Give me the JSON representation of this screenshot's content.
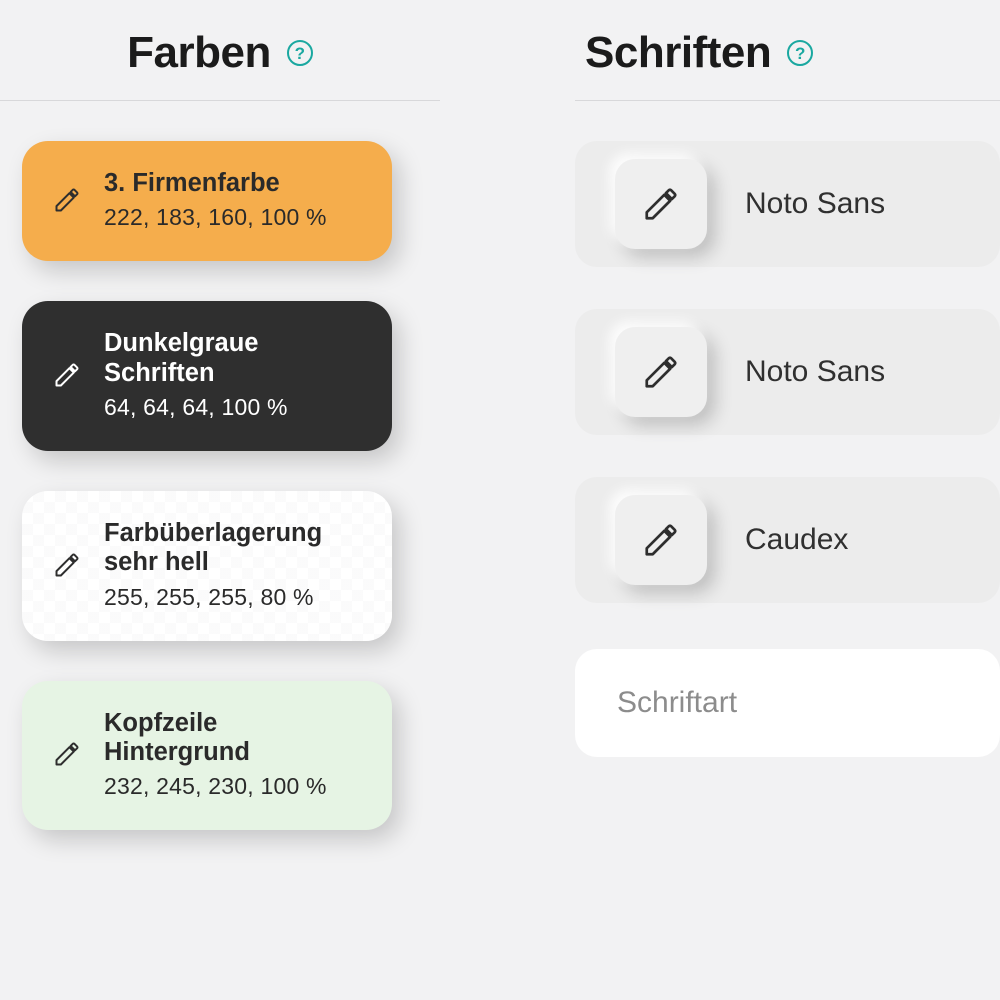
{
  "colors": {
    "heading": "Farben",
    "items": [
      {
        "title": "3. Firmenfarbe",
        "value": "222, 183, 160, 100 %",
        "variant": "orange"
      },
      {
        "title": "Dunkelgraue Schriften",
        "value": "64, 64, 64, 100 %",
        "variant": "darkgrey"
      },
      {
        "title": "Farbüberlagerung sehr hell",
        "value": "255, 255, 255, 80 %",
        "variant": "checker"
      },
      {
        "title": "Kopfzeile Hintergrund",
        "value": "232, 245, 230, 100 %",
        "variant": "mint"
      }
    ]
  },
  "fonts": {
    "heading": "Schriften",
    "items": [
      {
        "name": "Noto Sans"
      },
      {
        "name": "Noto Sans"
      },
      {
        "name": "Caudex"
      }
    ],
    "input_placeholder": "Schriftart"
  }
}
